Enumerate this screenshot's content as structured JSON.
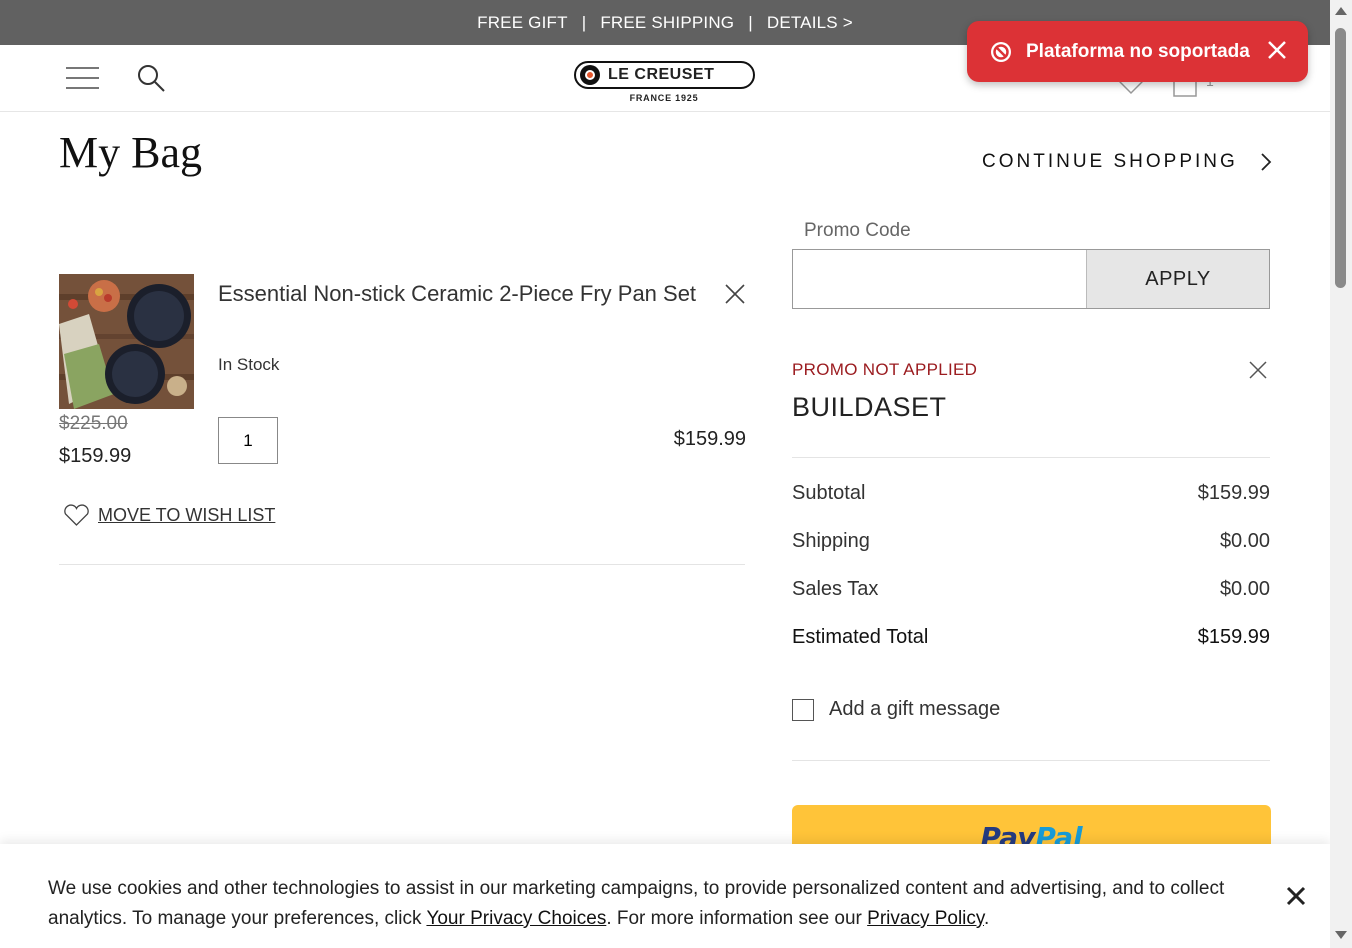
{
  "topbar": {
    "free_gift": "FREE GIFT",
    "sep1": "|",
    "free_shipping": "FREE SHIPPING",
    "sep2": "|",
    "details": "DETAILS >"
  },
  "header": {
    "logo_text": "LE CREUSET",
    "logo_sub": "FRANCE 1925",
    "cart_count": "1"
  },
  "toast": {
    "message": "Plataforma no soportada"
  },
  "page": {
    "title": "My Bag",
    "continue_shopping": "CONTINUE SHOPPING"
  },
  "item": {
    "name": "Essential Non-stick Ceramic 2-Piece Fry Pan Set",
    "stock": "In Stock",
    "old_price": "$225.00",
    "price": "$159.99",
    "quantity": "1",
    "line_price": "$159.99",
    "wishlist": "MOVE TO WISH LIST"
  },
  "promo": {
    "label": "Promo Code",
    "apply": "APPLY",
    "status": "PROMO NOT APPLIED",
    "code": "BUILDASET"
  },
  "summary": {
    "subtotal_label": "Subtotal",
    "subtotal_value": "$159.99",
    "shipping_label": "Shipping",
    "shipping_value": "$0.00",
    "tax_label": "Sales Tax",
    "tax_value": "$0.00",
    "total_label": "Estimated Total",
    "total_value": "$159.99",
    "gift_message": "Add a gift message"
  },
  "paypal": {
    "pay": "Pay",
    "pal": "Pal"
  },
  "cookie": {
    "text_1": "We use cookies and other technologies to assist in our marketing campaigns, to provide personalized content and advertising, and to collect analytics. To manage your preferences, click ",
    "link_1": "Your Privacy Choices",
    "text_2": ". For more information see our ",
    "link_2": "Privacy Policy",
    "text_3": "."
  },
  "colors": {
    "topbar_bg": "#616161",
    "toast_bg": "#dc3236",
    "promo_error": "#9b1c20",
    "paypal_yellow": "#ffc439",
    "paypal_blue": "#253b80",
    "paypal_light_blue": "#179bd7"
  }
}
